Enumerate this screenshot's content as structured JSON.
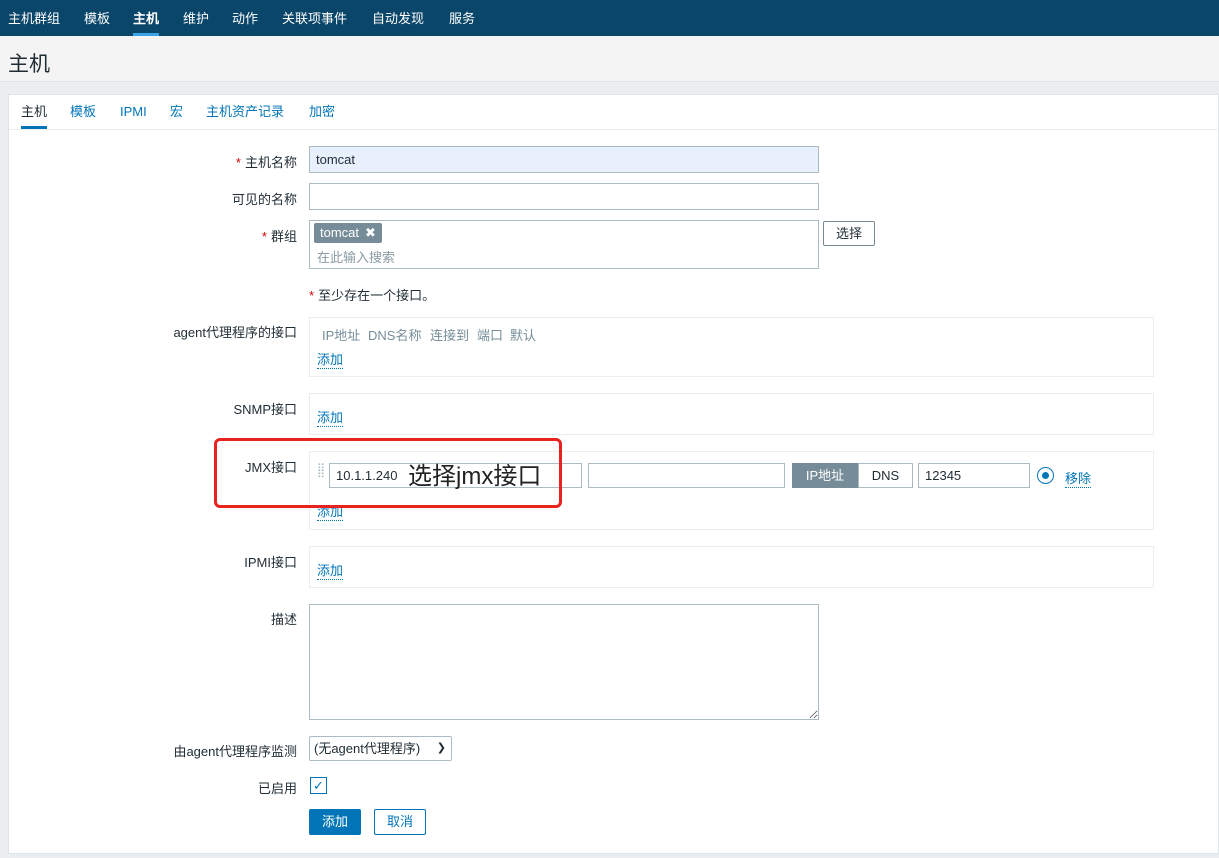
{
  "nav": {
    "items": [
      "主机群组",
      "模板",
      "主机",
      "维护",
      "动作",
      "关联项事件",
      "自动发现",
      "服务"
    ],
    "active_index": 2
  },
  "page": {
    "title": "主机"
  },
  "tabs": [
    "主机",
    "模板",
    "IPMI",
    "宏",
    "主机资产记录",
    "加密"
  ],
  "form": {
    "hostname": {
      "label": "主机名称",
      "value": "tomcat"
    },
    "visible_name": {
      "label": "可见的名称",
      "value": ""
    },
    "groups": {
      "label": "群组",
      "chip": "tomcat",
      "placeholder": "在此输入搜索",
      "select_button": "选择"
    },
    "interface_note": "至少存在一个接口。",
    "agent_iface": {
      "label": "agent代理程序的接口",
      "columns": [
        "IP地址",
        "DNS名称",
        "连接到",
        "端口",
        "默认"
      ],
      "add": "添加"
    },
    "snmp_iface": {
      "label": "SNMP接口",
      "add": "添加"
    },
    "jmx_iface": {
      "label": "JMX接口",
      "ip": "10.1.1.240",
      "dns": "",
      "connect_ip": "IP地址",
      "connect_dns": "DNS",
      "port": "12345",
      "remove": "移除",
      "add": "添加"
    },
    "ipmi_iface": {
      "label": "IPMI接口",
      "add": "添加"
    },
    "description": {
      "label": "描述",
      "value": ""
    },
    "proxy": {
      "label": "由agent代理程序监测",
      "selected": "(无agent代理程序)"
    },
    "enabled": {
      "label": "已启用",
      "checked": true
    },
    "submit": "添加",
    "cancel": "取消"
  },
  "annotation": {
    "text": "选择jmx接口",
    "color": "#e8231f"
  },
  "colors": {
    "nav_bg": "#0a466a",
    "accent": "#0275b8",
    "chip_bg": "#768d99"
  }
}
